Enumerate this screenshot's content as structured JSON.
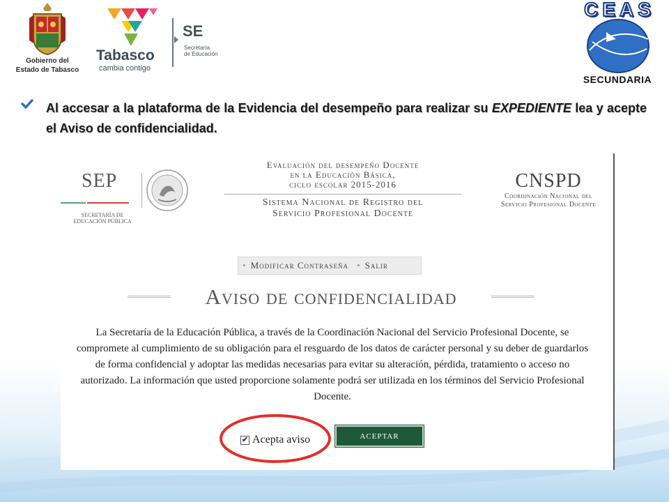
{
  "header": {
    "gobierno_logo_line1": "Gobierno del",
    "gobierno_logo_line2": "Estado de Tabasco",
    "tabasco_word": "Tabasco",
    "tabasco_tagline": "cambia contigo",
    "se_title": "SE",
    "se_subtitle_line1": "Secretaría",
    "se_subtitle_line2": "de Educación",
    "ceas_word": "CEAS",
    "ceas_subtitle": "SECUNDARIA"
  },
  "bullet": {
    "text_before": "Al accesar a la plataforma de la Evidencia del desempeño para realizar su ",
    "emphasis": "EXPEDIENTE",
    "text_after": " lea y acepte el Aviso de confidencialidad."
  },
  "screenshot": {
    "sep_word": "SEP",
    "sep_sub_line1": "SECRETARÍA DE",
    "sep_sub_line2": "EDUCACIÓN PÚBLICA",
    "eval_line1": "Evaluación del desempeño Docente",
    "eval_line2": "en la Educación Básica,",
    "eval_line3": "ciclo escolar 2015-2016",
    "system_line1": "Sistema Nacional de Registro del",
    "system_line2": "Servicio Profesional Docente",
    "cnspd_word": "CNSPD",
    "cnspd_sub_line1": "Coordinación Nacional del",
    "cnspd_sub_line2": "Servicio Profesional Docente",
    "nav": {
      "modify_password": "Modificar Contraseña",
      "logout": "Salir"
    },
    "aviso_title": "Aviso de confidencialidad",
    "notice_text": "La Secretaría de la Educación Pública, a través de la Coordinación Nacional del Servicio Profesional Docente, se compromete al cumplimiento de su obligación para el resguardo de los datos de carácter personal y su deber de guardarlos de forma confidencial y adoptar las medidas necesarias para evitar su alteración, pérdida, tratamiento o acceso no autorizado. La información que usted proporcione solamente podrá ser utilizada en los términos del Servicio Profesional Docente.",
    "checkbox_label": "Acepta aviso",
    "checkbox_checked": true,
    "accept_button": "ACEPTAR"
  },
  "colors": {
    "accept_button_bg": "#1e5a3a",
    "highlight_circle": "#e0302a",
    "ceas_blue": "#2f6fc4"
  }
}
